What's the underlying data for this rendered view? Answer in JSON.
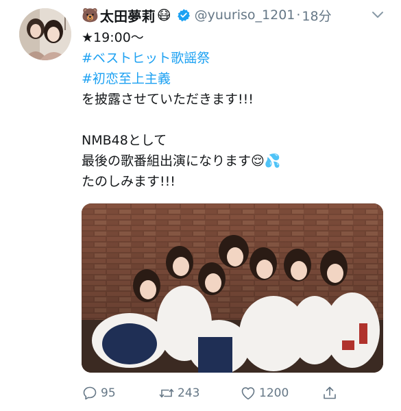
{
  "user": {
    "emoji_prefix": "🐻",
    "name": "太田夢莉",
    "emoji_suffix": "😷",
    "handle": "@yuuriso_1201",
    "separator": "·",
    "time": "18分"
  },
  "tweet": {
    "lines": [
      "★19:00〜",
      "#ベストヒット歌謡祭",
      "#初恋至上主義",
      "を披露させていただきます!!!",
      "",
      "NMB48として",
      "最後の歌番組出演になります😌💦",
      "たのしみます!!!"
    ]
  },
  "actions": {
    "replies": "95",
    "retweets": "243",
    "likes": "1200"
  },
  "icons": {
    "verified": "verified-badge-icon",
    "menu": "chevron-down-icon",
    "reply": "reply-icon",
    "retweet": "retweet-icon",
    "like": "heart-icon",
    "share": "share-icon"
  },
  "colors": {
    "link": "#1da1f2",
    "muted": "#657786",
    "text": "#14171a"
  }
}
